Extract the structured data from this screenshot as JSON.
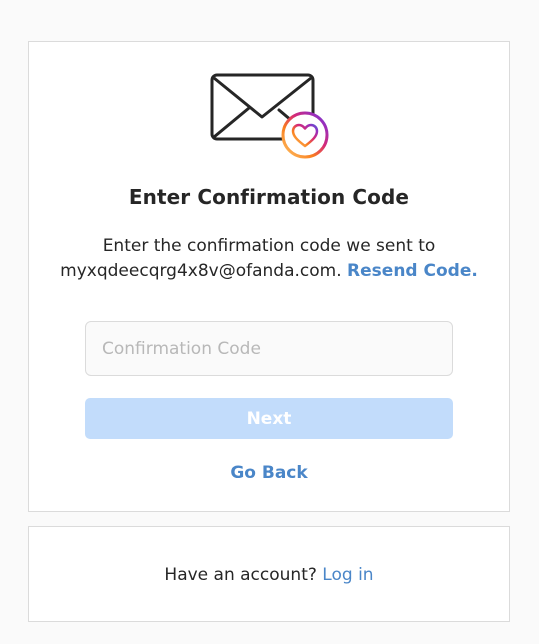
{
  "confirmation": {
    "title": "Enter Confirmation Code",
    "description_line1": "Enter the confirmation code we sent to",
    "email": "myxqdeecqrg4x8v@ofanda.com.",
    "resend_label": "Resend Code.",
    "input_placeholder": "Confirmation Code",
    "input_value": "",
    "next_label": "Next",
    "go_back_label": "Go Back"
  },
  "login_prompt": {
    "text": "Have an account?",
    "link_label": "Log in"
  },
  "colors": {
    "link_blue": "#4a86c8",
    "button_disabled": "#c2dcfb",
    "border": "#dbdbdb",
    "background": "#fafafa"
  },
  "icons": {
    "envelope": "envelope-icon",
    "heart_badge": "heart-badge-icon"
  }
}
